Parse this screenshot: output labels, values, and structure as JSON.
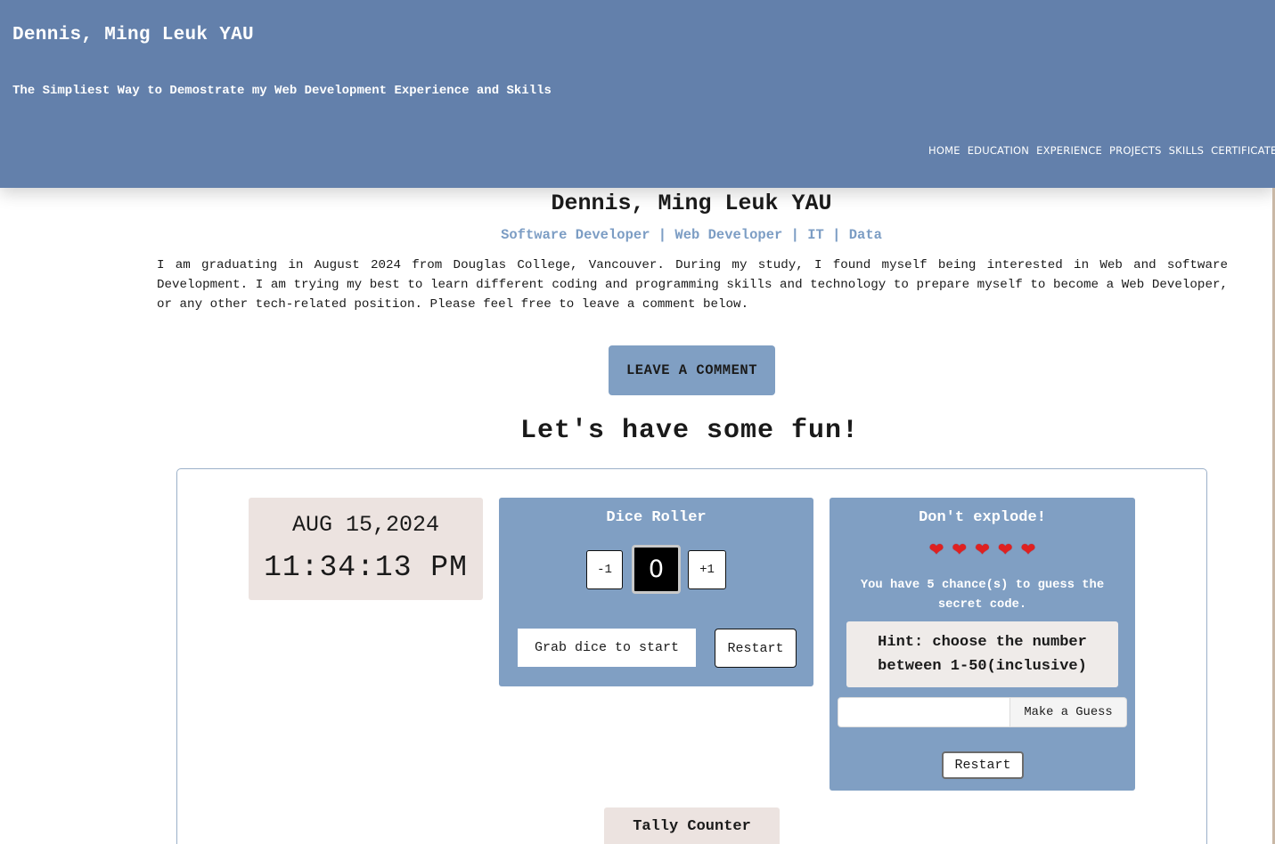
{
  "header": {
    "title": "Dennis, Ming Leuk YAU",
    "subtitle": "The Simpliest Way to Demostrate my Web Development Experience and Skills",
    "nav": [
      "HOME",
      "EDUCATION",
      "EXPERIENCE",
      "PROJECTS",
      "SKILLS",
      "CERTIFICATE"
    ],
    "background_color": "#6380ab"
  },
  "profile": {
    "name": "Dennis, Ming Leuk YAU",
    "roles": "Software Developer | Web Developer | IT | Data",
    "intro": "I am graduating in August 2024 from Douglas College, Vancouver. During my study, I found myself being interested in Web and software Development. I am trying my best to learn different coding and programming skills and technology to prepare myself to become a Web Developer, or any other tech-related position. Please feel free to leave a comment below.",
    "comment_button": "LEAVE A COMMENT"
  },
  "fun": {
    "heading": "Let's have some fun!",
    "clock": {
      "date": "AUG 15,2024",
      "time": "11:34:13 PM"
    },
    "dice": {
      "title": "Dice Roller",
      "minus": "-1",
      "value": "0",
      "plus": "+1",
      "grab": "Grab dice to start",
      "restart": "Restart"
    },
    "game": {
      "title": "Don't explode!",
      "lives": 5,
      "heart_icon": "❤️",
      "chances": "You have 5 chance(s) to guess the secret code.",
      "hint": "Hint: choose the number between 1-50(inclusive)",
      "guess_button": "Make a Guess",
      "restart": "Restart"
    },
    "tally": {
      "title": "Tally Counter"
    }
  },
  "colors": {
    "accent": "#809fc3",
    "panel_light": "#ece3e0"
  }
}
